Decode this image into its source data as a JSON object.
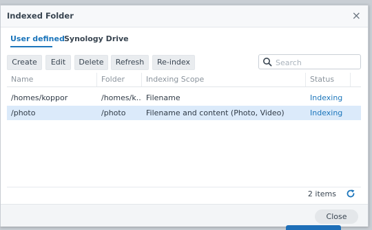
{
  "dialog": {
    "title": "Indexed Folder",
    "close_glyph": "×"
  },
  "tabs": [
    {
      "label": "User defined",
      "active": true
    },
    {
      "label": "Synology Drive",
      "active": false
    }
  ],
  "toolbar": {
    "create": "Create",
    "edit": "Edit",
    "delete": "Delete",
    "refresh": "Refresh",
    "reindex": "Re-index"
  },
  "search": {
    "placeholder": "Search",
    "value": ""
  },
  "grid": {
    "columns": [
      "Name",
      "Folder",
      "Indexing Scope",
      "Status"
    ],
    "rows": [
      {
        "name": "/homes/koppor",
        "folder": "/homes/k...",
        "scope": "Filename",
        "status": "Indexing",
        "selected": false
      },
      {
        "name": "/photo",
        "folder": "/photo",
        "scope": "Filename and content (Photo, Video)",
        "status": "Indexing",
        "selected": true
      }
    ]
  },
  "footer": {
    "count": "2 items"
  },
  "buttons": {
    "close": "Close"
  },
  "icons": {
    "search": "search-icon",
    "refresh": "refresh-icon",
    "close": "close-icon"
  },
  "colors": {
    "accent": "#1b75bb",
    "selected_row": "#dbeafa",
    "button_bg": "#e9ecef"
  }
}
